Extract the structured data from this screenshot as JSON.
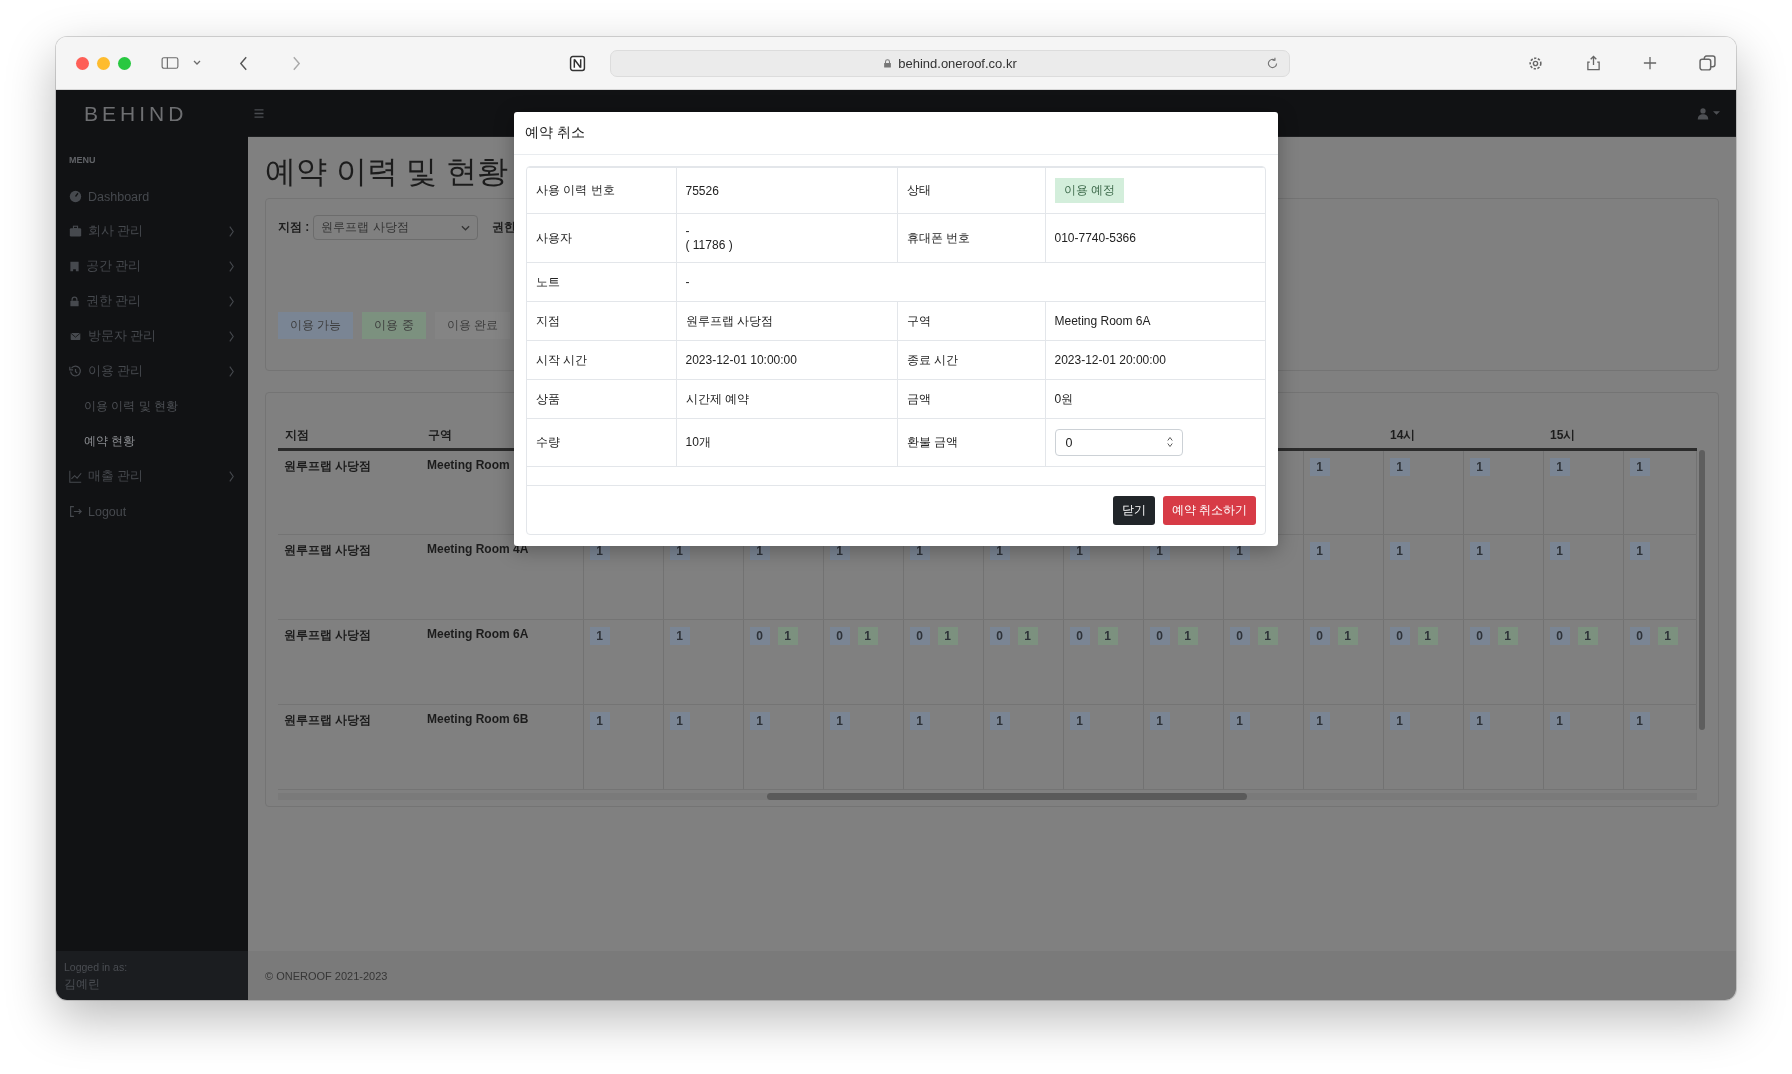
{
  "browser": {
    "url": "behind.oneroof.co.kr"
  },
  "app": {
    "logo": "BEHIND"
  },
  "sidebar": {
    "heading": "MENU",
    "items": [
      {
        "label": "Dashboard",
        "expandable": false
      },
      {
        "label": "회사 관리",
        "expandable": true
      },
      {
        "label": "공간 관리",
        "expandable": true
      },
      {
        "label": "권한 관리",
        "expandable": true
      },
      {
        "label": "방문자 관리",
        "expandable": true
      },
      {
        "label": "이용 관리",
        "expandable": true,
        "children": [
          {
            "label": "이용 이력 및 현황",
            "selected": false
          },
          {
            "label": "예약 현황",
            "selected": true
          }
        ]
      },
      {
        "label": "매출 관리",
        "expandable": true
      },
      {
        "label": "Logout",
        "expandable": false
      }
    ],
    "footer": {
      "caption": "Logged in as:",
      "user": "김예린"
    }
  },
  "page": {
    "title": "예약 이력 및 현황"
  },
  "filters": {
    "branch_label": "지점 :",
    "branch_value": "원루프랩 사당점",
    "permission_label": "권한",
    "legend": [
      {
        "label": "이용 가능",
        "kind": "available"
      },
      {
        "label": "이용 중",
        "kind": "in_use"
      },
      {
        "label": "이용 완료",
        "kind": "done"
      }
    ]
  },
  "table": {
    "columns": [
      "지점",
      "구역"
    ],
    "hours": [
      "14시",
      "15시"
    ],
    "rows": [
      {
        "branch": "원루프랩 사당점",
        "zone": "Meeting Room",
        "slots": [
          [
            {
              "text": "1",
              "kind": "available"
            }
          ],
          [
            {
              "text": "1",
              "kind": "available"
            }
          ],
          [
            {
              "text": "1",
              "kind": "available"
            }
          ],
          [
            {
              "text": "1",
              "kind": "available"
            }
          ],
          [
            {
              "text": "1",
              "kind": "available"
            }
          ]
        ]
      },
      {
        "branch": "원루프랩 사당점",
        "zone": "Meeting Room 4A",
        "slots": [
          [
            {
              "text": "1",
              "kind": "available"
            }
          ],
          [
            {
              "text": "1",
              "kind": "available"
            }
          ],
          [
            {
              "text": "1",
              "kind": "available"
            }
          ],
          [
            {
              "text": "1",
              "kind": "available"
            }
          ],
          [
            {
              "text": "1",
              "kind": "available"
            }
          ],
          [
            {
              "text": "1",
              "kind": "available"
            }
          ],
          [
            {
              "text": "1",
              "kind": "available"
            }
          ],
          [
            {
              "text": "1",
              "kind": "available"
            }
          ],
          [
            {
              "text": "1",
              "kind": "available"
            }
          ],
          [
            {
              "text": "1",
              "kind": "available"
            }
          ],
          [
            {
              "text": "1",
              "kind": "available"
            }
          ],
          [
            {
              "text": "1",
              "kind": "available"
            }
          ],
          [
            {
              "text": "1",
              "kind": "available"
            }
          ],
          [
            {
              "text": "1",
              "kind": "available"
            }
          ]
        ]
      },
      {
        "branch": "원루프랩 사당점",
        "zone": "Meeting Room 6A",
        "slots": [
          [
            {
              "text": "1",
              "kind": "available"
            }
          ],
          [
            {
              "text": "1",
              "kind": "available"
            }
          ],
          [
            {
              "text": "0",
              "kind": "available"
            },
            {
              "text": "1",
              "kind": "in_use"
            }
          ],
          [
            {
              "text": "0",
              "kind": "available"
            },
            {
              "text": "1",
              "kind": "in_use"
            }
          ],
          [
            {
              "text": "0",
              "kind": "available"
            },
            {
              "text": "1",
              "kind": "in_use"
            }
          ],
          [
            {
              "text": "0",
              "kind": "available"
            },
            {
              "text": "1",
              "kind": "in_use"
            }
          ],
          [
            {
              "text": "0",
              "kind": "available"
            },
            {
              "text": "1",
              "kind": "in_use"
            }
          ],
          [
            {
              "text": "0",
              "kind": "available"
            },
            {
              "text": "1",
              "kind": "in_use"
            }
          ],
          [
            {
              "text": "0",
              "kind": "available"
            },
            {
              "text": "1",
              "kind": "in_use"
            }
          ],
          [
            {
              "text": "0",
              "kind": "available"
            },
            {
              "text": "1",
              "kind": "in_use"
            }
          ],
          [
            {
              "text": "0",
              "kind": "available"
            },
            {
              "text": "1",
              "kind": "in_use"
            }
          ],
          [
            {
              "text": "0",
              "kind": "available"
            },
            {
              "text": "1",
              "kind": "in_use"
            }
          ],
          [
            {
              "text": "0",
              "kind": "available"
            },
            {
              "text": "1",
              "kind": "in_use"
            }
          ],
          [
            {
              "text": "0",
              "kind": "available"
            },
            {
              "text": "1",
              "kind": "in_use"
            }
          ]
        ]
      },
      {
        "branch": "원루프랩 사당점",
        "zone": "Meeting Room 6B",
        "slots": [
          [
            {
              "text": "1",
              "kind": "available"
            }
          ],
          [
            {
              "text": "1",
              "kind": "available"
            }
          ],
          [
            {
              "text": "1",
              "kind": "available"
            }
          ],
          [
            {
              "text": "1",
              "kind": "available"
            }
          ],
          [
            {
              "text": "1",
              "kind": "available"
            }
          ],
          [
            {
              "text": "1",
              "kind": "available"
            }
          ],
          [
            {
              "text": "1",
              "kind": "available"
            }
          ],
          [
            {
              "text": "1",
              "kind": "available"
            }
          ],
          [
            {
              "text": "1",
              "kind": "available"
            }
          ],
          [
            {
              "text": "1",
              "kind": "available"
            }
          ],
          [
            {
              "text": "1",
              "kind": "available"
            }
          ],
          [
            {
              "text": "1",
              "kind": "available"
            }
          ],
          [
            {
              "text": "1",
              "kind": "available"
            }
          ],
          [
            {
              "text": "1",
              "kind": "available"
            }
          ]
        ]
      }
    ]
  },
  "modal": {
    "title": "예약 취소",
    "rows": [
      {
        "fields": [
          {
            "label": "사용 이력 번호",
            "kind": "text",
            "value": "75526"
          },
          {
            "label": "상태",
            "kind": "badge",
            "value": "이용 예정"
          }
        ]
      },
      {
        "fields": [
          {
            "label": "사용자",
            "kind": "lines",
            "lines": [
              "-",
              "( 11786 )"
            ]
          },
          {
            "label": "휴대폰 번호",
            "kind": "text",
            "value": "010-7740-5366"
          }
        ]
      },
      {
        "fields": [
          {
            "label": "노트",
            "kind": "text",
            "value": "-"
          }
        ]
      },
      {
        "fields": [
          {
            "label": "지점",
            "kind": "text",
            "value": "원루프랩 사당점"
          },
          {
            "label": "구역",
            "kind": "text",
            "value": "Meeting Room 6A"
          }
        ]
      },
      {
        "fields": [
          {
            "label": "시작 시간",
            "kind": "text",
            "value": "2023-12-01 10:00:00"
          },
          {
            "label": "종료 시간",
            "kind": "text",
            "value": "2023-12-01 20:00:00"
          }
        ]
      },
      {
        "fields": [
          {
            "label": "상품",
            "kind": "text",
            "value": "시간제 예약"
          },
          {
            "label": "금액",
            "kind": "text",
            "value": "0원"
          }
        ]
      },
      {
        "fields": [
          {
            "label": "수량",
            "kind": "text",
            "value": "10개"
          },
          {
            "label": "환불 금액",
            "kind": "number_input",
            "value": "0"
          }
        ]
      }
    ],
    "buttons": [
      {
        "label": "닫기",
        "kind": "secondary"
      },
      {
        "label": "예약 취소하기",
        "kind": "danger"
      }
    ]
  },
  "footer": {
    "copyright": "© ONEROOF 2021-2023"
  }
}
